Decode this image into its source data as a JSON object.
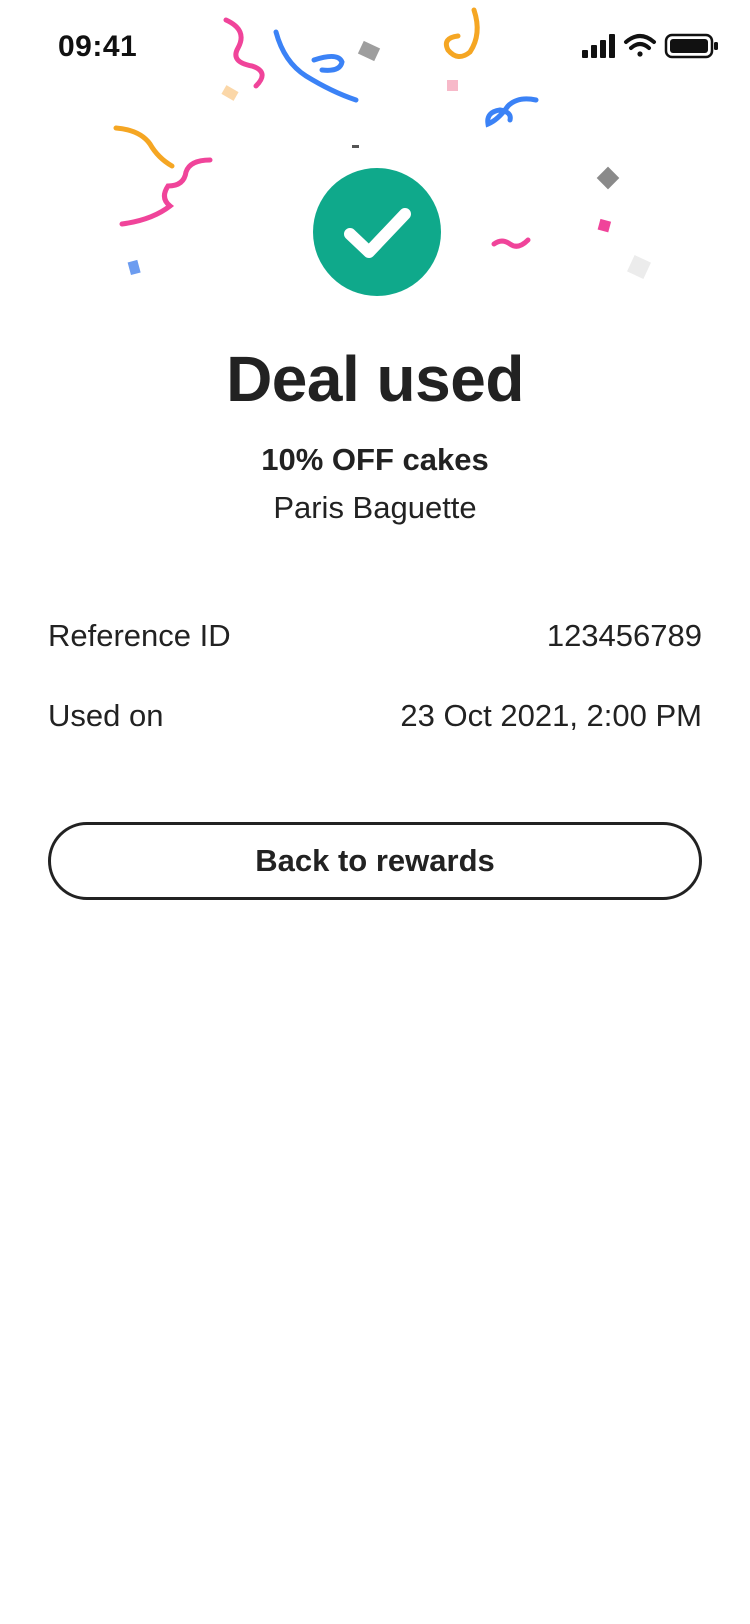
{
  "status_bar": {
    "time": "09:41",
    "icons": [
      "cellular-signal-icon",
      "wifi-icon",
      "battery-icon"
    ]
  },
  "success": {
    "icon": "checkmark-icon",
    "color": "#0fa98b",
    "title": "Deal used"
  },
  "deal": {
    "name": "10% OFF cakes",
    "merchant": "Paris Baguette"
  },
  "details": {
    "reference_label": "Reference ID",
    "reference_value": "123456789",
    "used_on_label": "Used on",
    "used_on_value": "23 Oct 2021, 2:00 PM"
  },
  "actions": {
    "back_label": "Back to rewards"
  },
  "colors": {
    "text": "#222222",
    "accent": "#0fa98b",
    "confetti": [
      "#f0449a",
      "#f5a623",
      "#3b82f6",
      "#9e9e9e",
      "#f7b9c9",
      "#fbd7a8"
    ]
  }
}
